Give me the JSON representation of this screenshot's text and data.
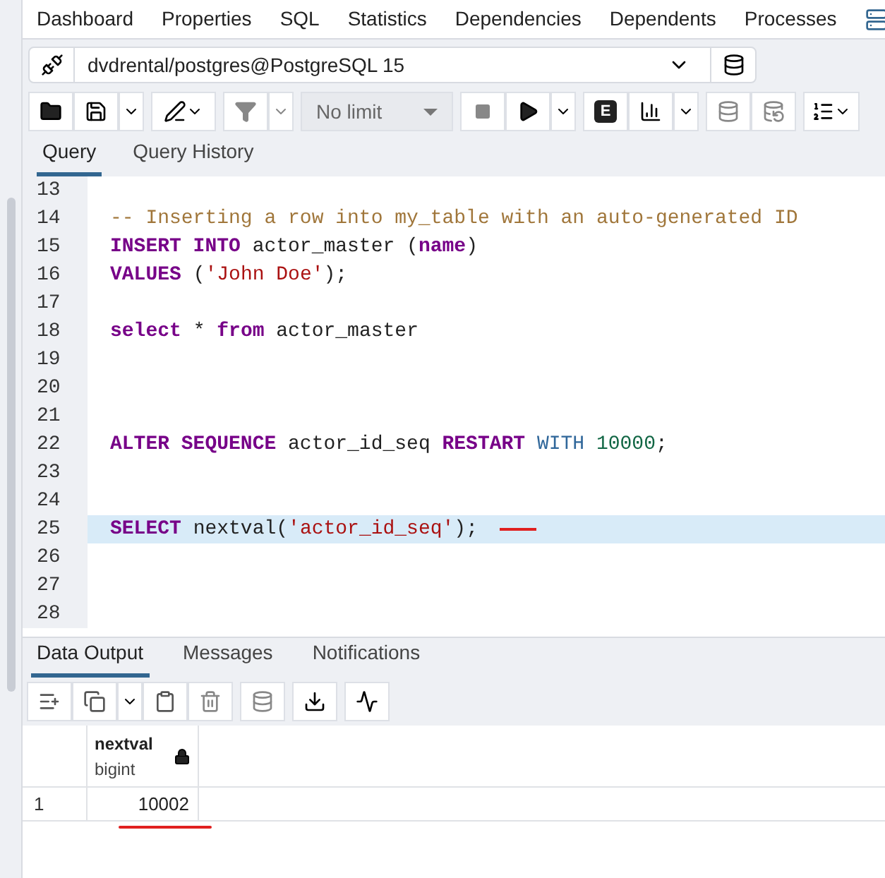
{
  "top_tabs": [
    {
      "label": "Dashboard",
      "selected": false
    },
    {
      "label": "Properties",
      "selected": false
    },
    {
      "label": "SQL",
      "selected": false
    },
    {
      "label": "Statistics",
      "selected": false
    },
    {
      "label": "Dependencies",
      "selected": false
    },
    {
      "label": "Dependents",
      "selected": false
    },
    {
      "label": "Processes",
      "selected": false
    }
  ],
  "connection": {
    "value": "dvdrental/postgres@PostgreSQL 15"
  },
  "toolbar": {
    "limit": "No limit",
    "explain_label": "E"
  },
  "editor_tabs": [
    {
      "label": "Query",
      "selected": true
    },
    {
      "label": "Query History",
      "selected": false
    }
  ],
  "editor": {
    "lines": [
      {
        "number": "13",
        "active": false
      },
      {
        "number": "14",
        "active": false,
        "tokens": [
          {
            "kind": "comment",
            "text": "-- Inserting a row into my_table with an auto-generated ID"
          }
        ]
      },
      {
        "number": "15",
        "active": false,
        "tokens": [
          {
            "kind": "keyword",
            "text": "INSERT INTO"
          },
          {
            "kind": "plain",
            "text": " actor_master ("
          },
          {
            "kind": "keyword",
            "text": "name"
          },
          {
            "kind": "plain",
            "text": ")"
          }
        ]
      },
      {
        "number": "16",
        "active": false,
        "tokens": [
          {
            "kind": "keyword",
            "text": "VALUES"
          },
          {
            "kind": "plain",
            "text": " ("
          },
          {
            "kind": "string",
            "text": "'John Doe'"
          },
          {
            "kind": "plain",
            "text": ");"
          }
        ]
      },
      {
        "number": "17",
        "active": false
      },
      {
        "number": "18",
        "active": false,
        "tokens": [
          {
            "kind": "keyword",
            "text": "select"
          },
          {
            "kind": "plain",
            "text": " * "
          },
          {
            "kind": "keyword",
            "text": "from"
          },
          {
            "kind": "plain",
            "text": " actor_master"
          }
        ]
      },
      {
        "number": "19",
        "active": false
      },
      {
        "number": "20",
        "active": false
      },
      {
        "number": "21",
        "active": false
      },
      {
        "number": "22",
        "active": false,
        "tokens": [
          {
            "kind": "keyword",
            "text": "ALTER SEQUENCE"
          },
          {
            "kind": "plain",
            "text": " actor_id_seq "
          },
          {
            "kind": "keyword",
            "text": "RESTART"
          },
          {
            "kind": "builtin",
            "text": " WITH"
          },
          {
            "kind": "number",
            "text": " 10000"
          },
          {
            "kind": "plain",
            "text": ";"
          }
        ]
      },
      {
        "number": "23",
        "active": false
      },
      {
        "number": "24",
        "active": false
      },
      {
        "number": "25",
        "active": true,
        "annotated": true,
        "tokens": [
          {
            "kind": "keyword",
            "text": "SELECT"
          },
          {
            "kind": "plain",
            "text": " nextval("
          },
          {
            "kind": "string",
            "text": "'actor_id_seq'"
          },
          {
            "kind": "plain",
            "text": ");"
          }
        ]
      },
      {
        "number": "26",
        "active": false
      },
      {
        "number": "27",
        "active": false
      },
      {
        "number": "28",
        "active": false
      }
    ]
  },
  "output_tabs": [
    {
      "label": "Data Output",
      "selected": true
    },
    {
      "label": "Messages",
      "selected": false
    },
    {
      "label": "Notifications",
      "selected": false
    }
  ],
  "result": {
    "columns": [
      {
        "name": "nextval",
        "type": "bigint"
      }
    ],
    "rows": [
      {
        "number": "1",
        "cells": [
          "10002"
        ],
        "annotated": true
      }
    ]
  }
}
